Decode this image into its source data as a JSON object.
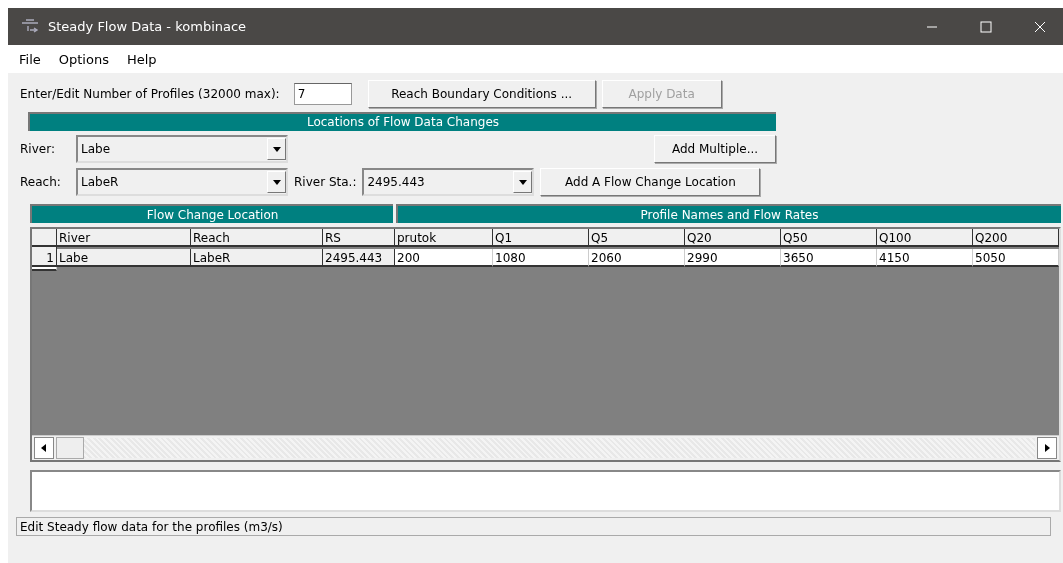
{
  "window": {
    "title": "Steady Flow Data - kombinace"
  },
  "menu": [
    "File",
    "Options",
    "Help"
  ],
  "profiles": {
    "label": "Enter/Edit Number of Profiles (32000 max):",
    "value": "7"
  },
  "buttons": {
    "reach_boundary": {
      "label": "Reach Boundary Conditions ...",
      "disabled": false
    },
    "apply": {
      "label": "Apply Data",
      "disabled": true
    },
    "add_multiple": {
      "label": "Add Multiple...",
      "disabled": false
    },
    "add_location": {
      "label": "Add A Flow Change Location",
      "disabled": false
    }
  },
  "locations_header": "Locations of Flow Data Changes",
  "river": {
    "label": "River:",
    "value": "Labe"
  },
  "reach": {
    "label": "Reach:",
    "value": "LabeR"
  },
  "river_sta": {
    "label": "River Sta.:",
    "value": "2495.443"
  },
  "table": {
    "group_headers": [
      "Flow Change Location",
      "Profile Names and Flow Rates"
    ],
    "columns": [
      "River",
      "Reach",
      "RS",
      "prutok",
      "Q1",
      "Q5",
      "Q20",
      "Q50",
      "Q100",
      "Q200"
    ],
    "rows": [
      {
        "number": "1",
        "cells": [
          "Labe",
          "LabeR",
          "2495.443",
          "200",
          "1080",
          "2060",
          "2990",
          "3650",
          "4150",
          "5050"
        ]
      }
    ]
  },
  "status_bar": "Edit Steady flow data for the profiles (m3/s)"
}
